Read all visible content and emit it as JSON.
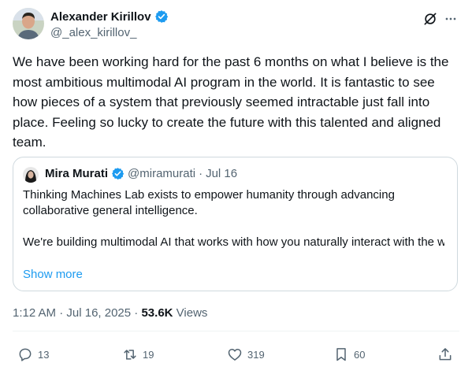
{
  "author": {
    "name": "Alexander Kirillov",
    "handle": "@_alex_kirillov_",
    "verified": true
  },
  "header_icons": [
    "grok-icon",
    "more-icon"
  ],
  "tweet": {
    "text": "We have been working hard for the past 6 months on what I believe is the most ambitious multimodal AI program in the world. It is fantastic to see how pieces of a system that previously seemed intractable just fall into place. Feeling so lucky to create the future with this talented and aligned team."
  },
  "quote": {
    "name": "Mira Murati",
    "handle": "@miramurati",
    "separator": "·",
    "date": "Jul 16",
    "paragraph1": "Thinking Machines Lab exists to empower humanity through advancing collaborative general intelligence.",
    "paragraph2": "We're building multimodal AI that works with how you naturally interact with the world - through conversation, through sight, through the messy way we ...",
    "show_more": "Show more"
  },
  "meta": {
    "time": "1:12 AM",
    "separator": "·",
    "date": "Jul 16, 2025",
    "views_count": "53.6K",
    "views_label": "Views"
  },
  "actions": {
    "replies": "13",
    "reposts": "19",
    "likes": "319",
    "bookmarks": "60"
  },
  "colors": {
    "text": "#0f1419",
    "secondary": "#536471",
    "link": "#1d9bf0",
    "verified": "#1d9bf0",
    "border": "#cfd9de",
    "divider": "#eff3f4"
  }
}
